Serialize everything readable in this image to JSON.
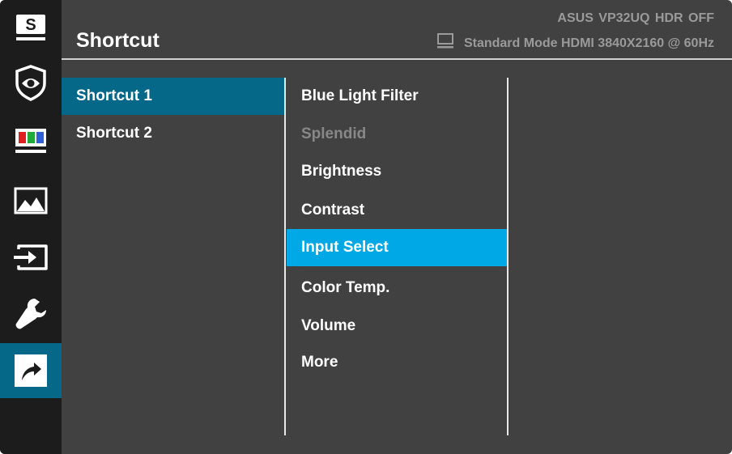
{
  "header": {
    "title": "Shortcut",
    "model_line": "ASUS  VP32UQ  HDR OFF",
    "mode_line": "Standard Mode HDMI 3840X2160 @ 60Hz"
  },
  "rail": {
    "items": [
      {
        "name": "splendid-icon",
        "glyph": "S"
      },
      {
        "name": "eye-care-icon"
      },
      {
        "name": "color-icon"
      },
      {
        "name": "image-icon"
      },
      {
        "name": "input-select-icon"
      },
      {
        "name": "system-setup-icon"
      },
      {
        "name": "shortcut-icon",
        "active": true
      }
    ]
  },
  "column1": {
    "items": [
      {
        "label": "Shortcut 1",
        "active": true
      },
      {
        "label": "Shortcut 2",
        "active": false
      }
    ]
  },
  "column2": {
    "items": [
      {
        "label": "Blue Light Filter",
        "state": "normal"
      },
      {
        "label": "Splendid",
        "state": "disabled"
      },
      {
        "label": "Brightness",
        "state": "normal"
      },
      {
        "label": "Contrast",
        "state": "normal"
      },
      {
        "label": "Input Select",
        "state": "selected"
      },
      {
        "label": "Color Temp.",
        "state": "normal"
      },
      {
        "label": "Volume",
        "state": "normal"
      },
      {
        "label": "More",
        "state": "normal"
      }
    ]
  },
  "colors": {
    "background": "#414141",
    "rail": "#1c1c1c",
    "active_teal": "#066888",
    "selected_blue": "#00a9e6",
    "disabled_text": "#888888"
  }
}
